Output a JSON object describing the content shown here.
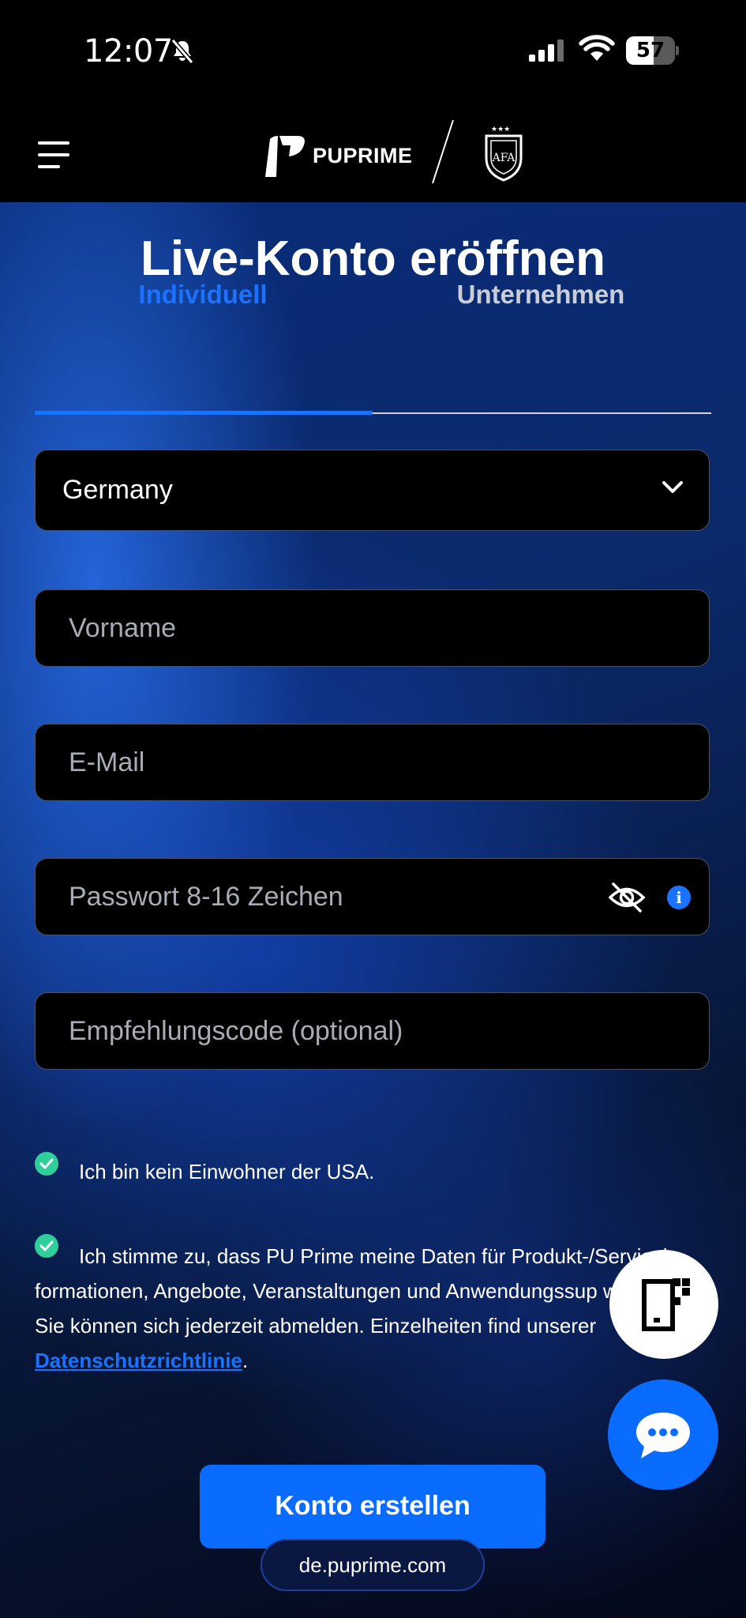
{
  "status_bar": {
    "time": "12:07",
    "battery_level": "57",
    "battery_fraction": 0.57,
    "icons": [
      "bell-slash-icon",
      "signal-icon",
      "wifi-icon",
      "battery-icon"
    ]
  },
  "header": {
    "menu_icon": "hamburger-menu-icon",
    "brand_name": "PUPRIME",
    "logo_icon": "puprime-logo-icon",
    "partner_crest_icon": "afa-crest-icon"
  },
  "page": {
    "title": "Live-Konto eröffnen"
  },
  "tabs": {
    "individual": "Individuell",
    "company": "Unternehmen",
    "active": "individual"
  },
  "form": {
    "country": "Germany",
    "first_name_placeholder": "Vorname",
    "email_placeholder": "E-Mail",
    "password_placeholder": "Passwort 8-16 Zeichen",
    "referral_placeholder": "Empfehlungscode (optional)",
    "info_symbol": "i"
  },
  "consent": {
    "usa_text": "Ich bin kein Einwohner der USA.",
    "marketing_text": "Ich stimme zu, dass PU Prime meine Daten für Produkt-/Servicein-formationen, Angebote, Veranstaltungen und Anwendungssup wendet. Sie können sich jederzeit abmelden. Einzelheiten find unserer ",
    "privacy_link": "Datenschutzrichtlinie",
    "trailing": "."
  },
  "actions": {
    "submit": "Konto erstellen",
    "url": "de.puprime.com"
  },
  "colors": {
    "accent": "#1a73ff",
    "button": "#0a6cff",
    "check": "#2ecf9b",
    "background": "#000000"
  }
}
